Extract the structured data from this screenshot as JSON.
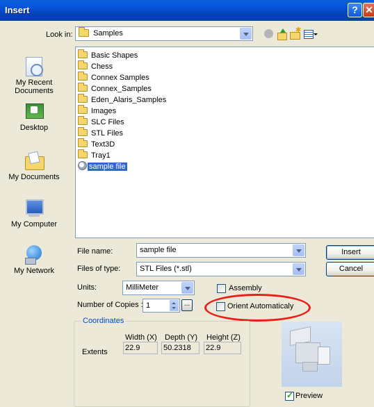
{
  "window": {
    "title": "Insert"
  },
  "look_in": {
    "label": "Look in:",
    "value": "Samples"
  },
  "toolbar_icons": [
    "back-icon",
    "up-folder-icon",
    "new-folder-icon",
    "views-menu-icon"
  ],
  "places": [
    {
      "label": "My Recent Documents",
      "icon": "recent-documents-icon"
    },
    {
      "label": "Desktop",
      "icon": "desktop-icon"
    },
    {
      "label": "My Documents",
      "icon": "my-documents-icon"
    },
    {
      "label": "My Computer",
      "icon": "my-computer-icon"
    },
    {
      "label": "My Network",
      "icon": "network-icon"
    }
  ],
  "files": [
    {
      "name": "Basic Shapes",
      "type": "folder"
    },
    {
      "name": "Chess",
      "type": "folder"
    },
    {
      "name": "Connex Samples",
      "type": "folder"
    },
    {
      "name": "Connex_Samples",
      "type": "folder"
    },
    {
      "name": "Eden_Alaris_Samples",
      "type": "folder"
    },
    {
      "name": "Images",
      "type": "folder"
    },
    {
      "name": "SLC Files",
      "type": "folder"
    },
    {
      "name": "STL Files",
      "type": "folder"
    },
    {
      "name": "Text3D",
      "type": "folder"
    },
    {
      "name": "Tray1",
      "type": "folder"
    },
    {
      "name": "sample file",
      "type": "file",
      "selected": true
    }
  ],
  "file_name": {
    "label": "File name:",
    "value": "sample file"
  },
  "file_type": {
    "label": "Files of type:",
    "value": "STL Files (*.stl)"
  },
  "buttons": {
    "insert": "Insert",
    "cancel": "Cancel",
    "browse": "..."
  },
  "units": {
    "label": "Units:",
    "value": "MilliMeter"
  },
  "assembly": {
    "label": "Assembly",
    "checked": false
  },
  "copies": {
    "label": "Number of Copies :",
    "value": "1"
  },
  "orient": {
    "label": "Orient Automaticaly",
    "checked": false,
    "highlight_color": "#E8201A"
  },
  "coordinates": {
    "title": "Coordinates",
    "headers": {
      "width": "Width (X)",
      "depth": "Depth (Y)",
      "height": "Height (Z)"
    },
    "extents_label": "Extents",
    "width": "22.9",
    "depth": "50.2318",
    "height": "22.9"
  },
  "preview": {
    "label": "Preview",
    "checked": true
  },
  "colors": {
    "accent": "#316AC5",
    "title_bar": "#0A5FD8",
    "dialog_bg": "#ECE9D8"
  }
}
